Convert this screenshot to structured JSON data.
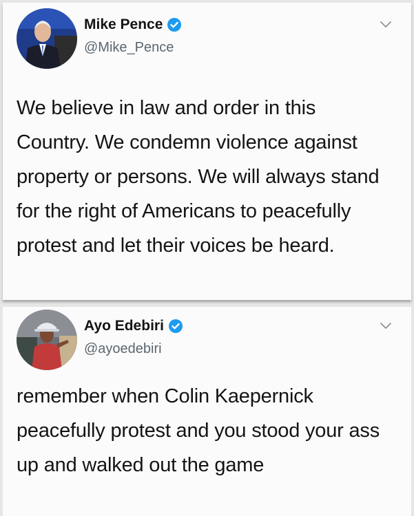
{
  "tweets": [
    {
      "name": "Mike Pence",
      "handle": "@Mike_Pence",
      "avatar_icon": "profile-photo",
      "verified_icon": "verified-badge-icon",
      "text": "We believe in law and order in this Country. We condemn violence against property or persons. We will always stand for the right of Americans to peacefully protest and let their voices be heard."
    },
    {
      "name": "Ayo Edebiri",
      "handle": "@ayoedebiri",
      "avatar_icon": "profile-photo",
      "verified_icon": "verified-badge-icon",
      "text": "remember when Colin Kaepernick peacefully protest and you stood your ass up and walked out the game"
    }
  ],
  "colors": {
    "verified_blue": "#1d9bf0",
    "handle_gray": "#5b6670",
    "background": "#e6e6e6",
    "card": "#fbfbfb"
  }
}
